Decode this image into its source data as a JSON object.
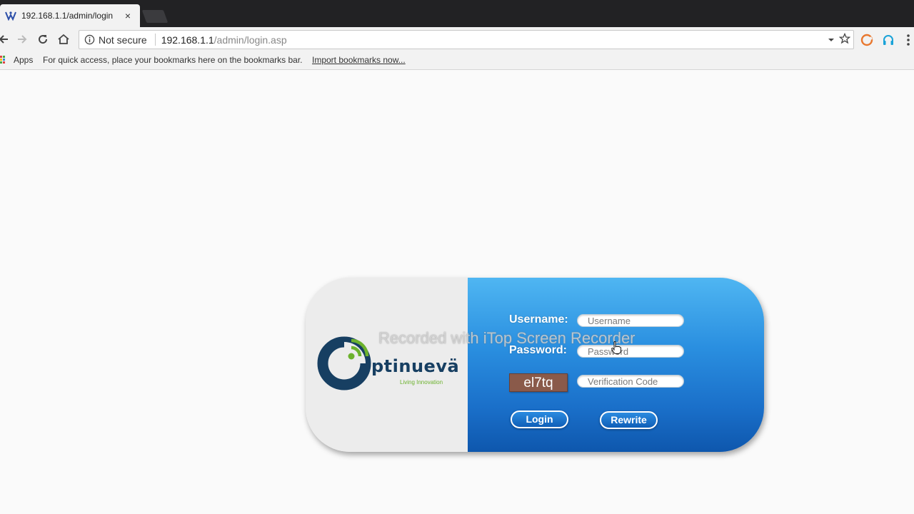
{
  "browser": {
    "tab": {
      "title": "192.168.1.1/admin/login",
      "close": "×"
    },
    "security_label": "Not secure",
    "url_host": "192.168.1.1",
    "url_path": "/admin/login.asp",
    "bookmarks": {
      "apps_label": "Apps",
      "hint": "For quick access, place your bookmarks here on the bookmarks bar.",
      "import_link": "Import bookmarks now..."
    },
    "icons": [
      "back-icon",
      "forward-icon",
      "reload-icon",
      "home-icon",
      "info-icon",
      "dropdown-icon",
      "star-icon",
      "extension-icon",
      "headphones-icon",
      "menu-icon"
    ]
  },
  "login": {
    "username_label": "Username:",
    "username_placeholder": "Username",
    "password_label": "Password:",
    "password_placeholder": "Password",
    "captcha_text": "el7tq",
    "verification_placeholder": "Verification Code",
    "login_button": "Login",
    "rewrite_button": "Rewrite"
  },
  "brand": {
    "logo_text": "ptinuevä",
    "tagline": "Living Innovation",
    "colors": {
      "navy": "#173f62",
      "green": "#6cb22d",
      "panel_blue": "#2a8fe0"
    }
  },
  "overlay": {
    "watermark": "Recorded with iTop Screen Recorder"
  }
}
